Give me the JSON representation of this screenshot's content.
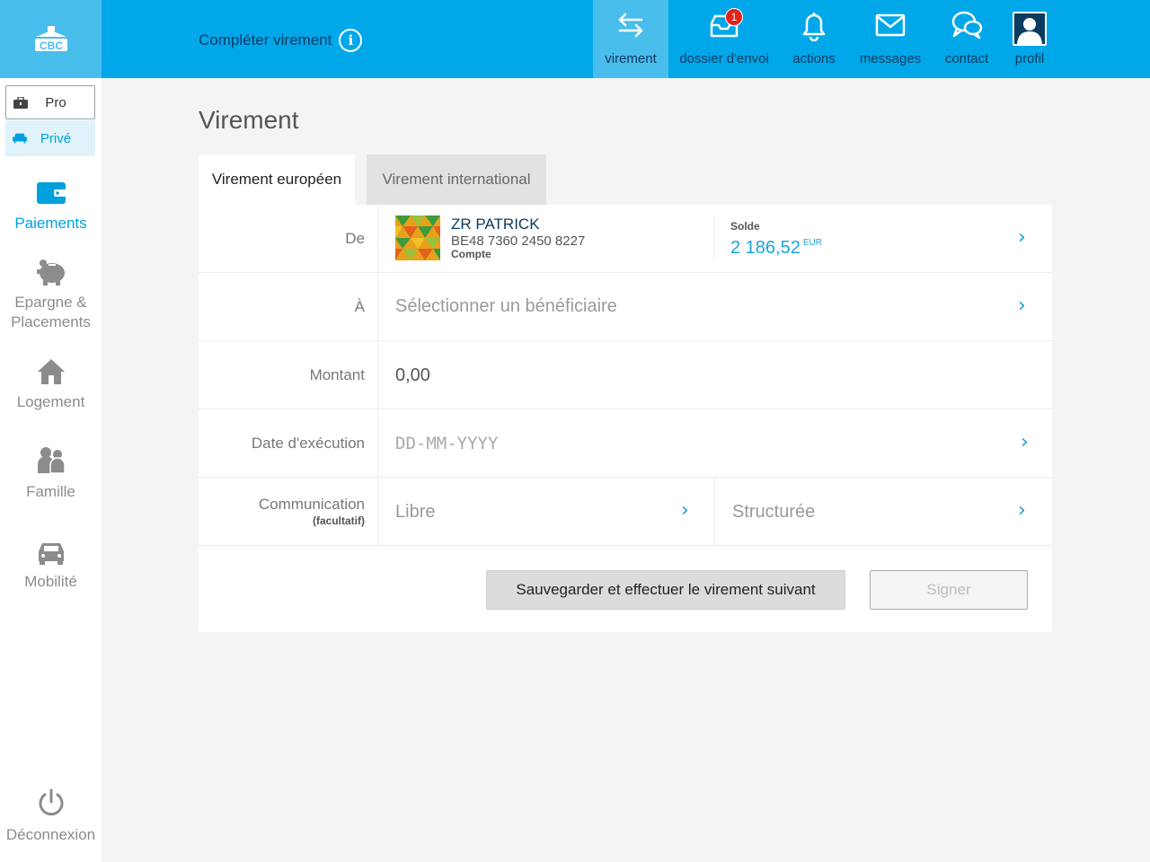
{
  "header": {
    "logo_text": "CBC",
    "page_heading": "Compléter virement",
    "nav": [
      {
        "label": "virement",
        "icon": "transfer-arrows-icon",
        "active": true
      },
      {
        "label": "dossier d'envoi",
        "icon": "inbox-tray-icon",
        "badge": "1"
      },
      {
        "label": "actions",
        "icon": "bell-icon"
      },
      {
        "label": "messages",
        "icon": "envelope-icon"
      },
      {
        "label": "contact",
        "icon": "chat-bubbles-icon"
      },
      {
        "label": "profil",
        "icon": "user-avatar-icon"
      }
    ]
  },
  "sidebar": {
    "segments": {
      "pro": "Pro",
      "prive": "Privé"
    },
    "items": [
      {
        "label": "Paiements",
        "icon": "wallet-icon",
        "active": true
      },
      {
        "label": "Epargne &\nPlacements",
        "icon": "piggy-bank-icon"
      },
      {
        "label": "Logement",
        "icon": "house-icon"
      },
      {
        "label": "Famille",
        "icon": "family-icon"
      },
      {
        "label": "Mobilité",
        "icon": "car-icon"
      }
    ],
    "logout": "Déconnexion"
  },
  "main": {
    "title": "Virement",
    "tabs": [
      {
        "label": "Virement européen",
        "active": true
      },
      {
        "label": "Virement international",
        "active": false
      }
    ],
    "form": {
      "from_label": "De",
      "account_name": "ZR PATRICK",
      "account_iban": "BE48 7360 2450 8227",
      "account_type": "Compte",
      "balance_label": "Solde",
      "balance_value": "2 186,52",
      "balance_currency": "EUR",
      "to_label": "À",
      "to_placeholder": "Sélectionner un bénéficiaire",
      "amount_label": "Montant",
      "amount_value": "0,00",
      "date_label": "Date d'exécution",
      "date_placeholder": "DD-MM-YYYY",
      "comm_label": "Communication",
      "comm_sub": "(facultatif)",
      "comm_free": "Libre",
      "comm_structured": "Structurée"
    },
    "buttons": {
      "save": "Sauvegarder et effectuer le virement suivant",
      "sign": "Signer"
    }
  },
  "colors": {
    "brand_blue": "#00a7e9",
    "active_blue": "#49bdec",
    "accent": "#00a0df",
    "badge_red": "#e2231a"
  }
}
